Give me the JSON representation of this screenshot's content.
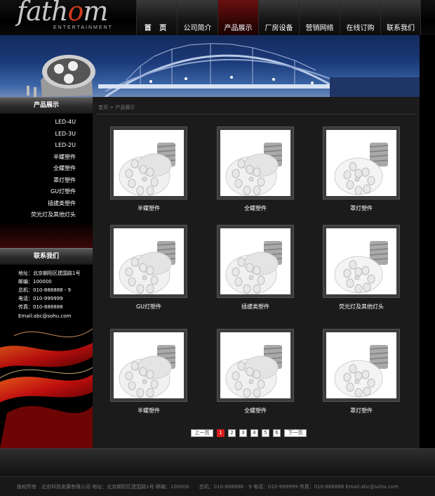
{
  "brand": {
    "name": "fathom",
    "tagline": "ENTERTAINMENT"
  },
  "nav": [
    {
      "label": "首 页"
    },
    {
      "label": "公司简介"
    },
    {
      "label": "产品展示"
    },
    {
      "label": "厂房设备"
    },
    {
      "label": "营销网络"
    },
    {
      "label": "在线订购"
    },
    {
      "label": "联系我们"
    }
  ],
  "nav_active_index": 2,
  "sidebar": {
    "products_title": "产品展示",
    "products": [
      "LED-4U",
      "LED-3U",
      "LED-2U",
      "半螺塑件",
      "全螺塑件",
      "罩灯塑件",
      "GU灯塑件",
      "插拔类塑件",
      "荧光灯及其他灯头"
    ],
    "contact_title": "联系我们",
    "contact": {
      "address": "地址：北京朝阳区建国路1号",
      "zip": "邮编：100000",
      "hq": "总机：010-888888 - 9",
      "phone": "电话：010-999999",
      "fax": "传真：010-888888",
      "email": "Email:abc@sohu.com"
    }
  },
  "breadcrumb": {
    "home": "首页",
    "sep": ">",
    "current": "产品展示"
  },
  "products": [
    {
      "name": "半螺塑件",
      "style": "half"
    },
    {
      "name": "全螺塑件",
      "style": "full"
    },
    {
      "name": "罩灯塑件",
      "style": "cover"
    },
    {
      "name": "GU灯塑件",
      "style": "half"
    },
    {
      "name": "插拔类塑件",
      "style": "full"
    },
    {
      "name": "荧光灯及其他灯头",
      "style": "cover"
    },
    {
      "name": "半螺塑件",
      "style": "half"
    },
    {
      "name": "全螺塑件",
      "style": "full"
    },
    {
      "name": "罩灯塑件",
      "style": "cover"
    }
  ],
  "pager": {
    "prev": "上一页",
    "pages": [
      "1",
      "2",
      "3",
      "4",
      "5",
      "6"
    ],
    "current": "1",
    "next": "下一页"
  },
  "footer": {
    "text": "版权所有　北京科技发展有限公司 地址：北京朝阳区建国路1号 邮编：100000　　总机：010-888888 - 9 电话：010-999999 传真：010-888888 Email:abc@sohu.com"
  },
  "colors": {
    "accent_red": "#d61c1c",
    "main_bg": "#1b1b1b"
  }
}
